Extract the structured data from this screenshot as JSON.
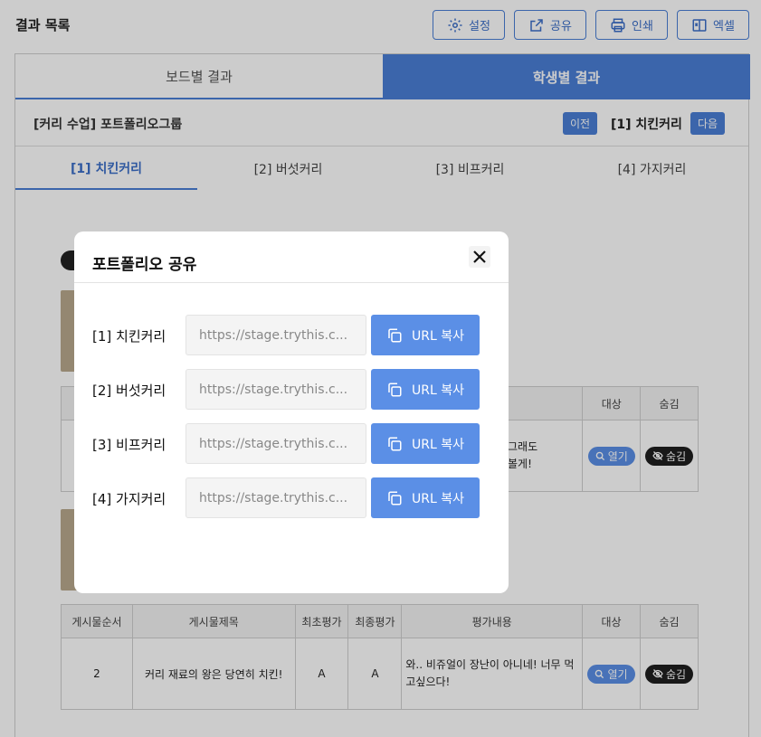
{
  "header": {
    "title": "결과 목록",
    "buttons": [
      {
        "label": "설정",
        "icon": "gear-icon"
      },
      {
        "label": "공유",
        "icon": "share-icon"
      },
      {
        "label": "인쇄",
        "icon": "printer-icon"
      },
      {
        "label": "엑셀",
        "icon": "excel-icon"
      }
    ]
  },
  "main_tabs": [
    {
      "label": "보드별 결과",
      "active": false
    },
    {
      "label": "학생별 결과",
      "active": true
    }
  ],
  "group": {
    "title": "[커리 수업] 포트폴리오그룹",
    "prev_label": "이전",
    "current": "[1] 치킨커리",
    "next_label": "다음"
  },
  "sub_tabs": [
    {
      "label": "[1] 치킨커리",
      "active": true
    },
    {
      "label": "[2] 버섯커리",
      "active": false
    },
    {
      "label": "[3] 비프커리",
      "active": false
    },
    {
      "label": "[4] 가지커리",
      "active": false
    }
  ],
  "table1": {
    "headers": [
      "대상",
      "숨김"
    ],
    "row": {
      "eval_line1": "그래도",
      "eval_line2": "볼게!",
      "open_label": "열기",
      "hide_label": "숨김"
    }
  },
  "table2": {
    "headers": [
      "게시물순서",
      "게시물제목",
      "최초평가",
      "최종평가",
      "평가내용",
      "대상",
      "숨김"
    ],
    "row": {
      "order": "2",
      "title": "커리 재료의 왕은 당연히 치킨!",
      "first_grade": "A",
      "final_grade": "A",
      "eval": "와.. 비쥬얼이 장난이 아니네! 너무 먹고싶으다!",
      "open_label": "열기",
      "hide_label": "숨김"
    }
  },
  "modal": {
    "title": "포트폴리오 공유",
    "copy_label": "URL 복사",
    "rows": [
      {
        "label": "[1] 치킨커리",
        "url": "https://stage.trythis.c..."
      },
      {
        "label": "[2] 버섯커리",
        "url": "https://stage.trythis.c..."
      },
      {
        "label": "[3] 비프커리",
        "url": "https://stage.trythis.c..."
      },
      {
        "label": "[4] 가지커리",
        "url": "https://stage.trythis.c..."
      }
    ]
  },
  "colors": {
    "accent": "#4a7fd6",
    "button_blue": "#5b8fe6",
    "dark_pill": "#1e1e1e"
  }
}
